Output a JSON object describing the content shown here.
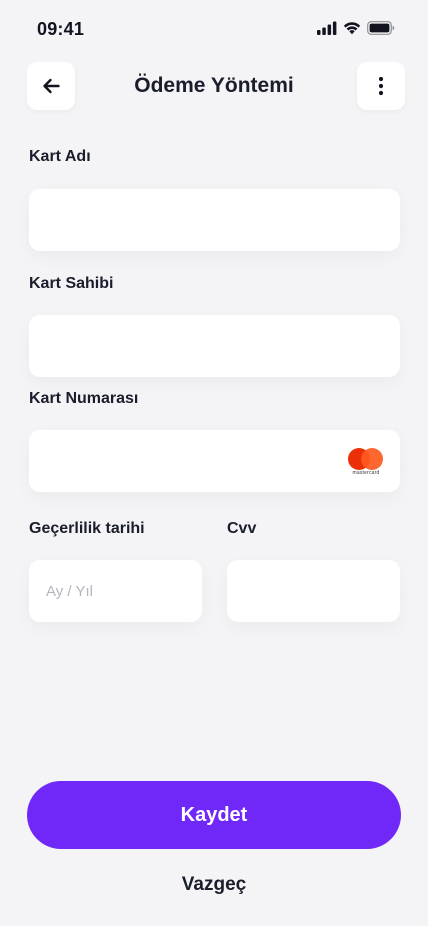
{
  "status_bar": {
    "time": "09:41"
  },
  "header": {
    "title": "Ödeme Yöntemi",
    "back_icon": "arrow-left-icon",
    "menu_icon": "more-vertical-icon"
  },
  "form": {
    "card_name": {
      "label": "Kart Adı",
      "value": "",
      "placeholder": ""
    },
    "card_holder": {
      "label": "Kart Sahibi",
      "value": "",
      "placeholder": ""
    },
    "card_number": {
      "label": "Kart Numarası",
      "value": "",
      "placeholder": "",
      "brand_logo_text": "mastercard"
    },
    "expiry": {
      "label": "Geçerlilik tarihi",
      "value": "",
      "placeholder": "Ay / Yıl"
    },
    "cvv": {
      "label": "Cvv",
      "value": "",
      "placeholder": ""
    }
  },
  "actions": {
    "save_label": "Kaydet",
    "cancel_label": "Vazgeç"
  },
  "colors": {
    "background": "#f4f4f6",
    "primary": "#7028f8",
    "text": "#1a1d2b",
    "mastercard_red": "#eb2f06",
    "mastercard_orange": "#ff5a1f"
  }
}
